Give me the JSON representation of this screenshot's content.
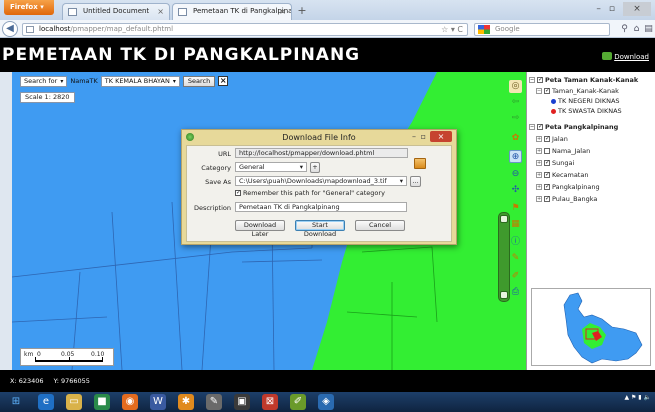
{
  "browser": {
    "app_button": "Firefox",
    "tabs": [
      {
        "label": "Untitled Document"
      },
      {
        "label": "Pemetaan TK di Pangkalpinang"
      }
    ],
    "url_host": "localhost",
    "url_path": "/pmapper/map_default.phtml",
    "search_engine": "Google"
  },
  "header": {
    "title": "PEMETAAN TK DI PANGKALPINANG",
    "download_label": "Download"
  },
  "toolbar": {
    "search_for": "Search for",
    "field": "NamaTK",
    "value": "TK KEMALA BHAYAN",
    "search_button": "Search",
    "scale_label": "Scale 1:",
    "scale_value": "2820"
  },
  "scalebar": {
    "unit": "km",
    "ticks": [
      "0",
      "0.05",
      "0.10"
    ]
  },
  "layers": {
    "groups": [
      {
        "label": "Peta Taman Kanak-Kanak",
        "items": [
          {
            "label": "Taman_Kanak-Kanak",
            "checked": true
          },
          {
            "label": "TK NEGERI DIKNAS",
            "legend_color": "#1a3fd0"
          },
          {
            "label": "TK SWASTA DIKNAS",
            "legend_color": "#e02020"
          }
        ]
      },
      {
        "label": "Peta Pangkalpinang",
        "items": [
          {
            "label": "Jalan",
            "checked": true
          },
          {
            "label": "Nama_Jalan",
            "checked": false
          },
          {
            "label": "Sungai",
            "checked": true
          },
          {
            "label": "Kecamatan",
            "checked": true
          },
          {
            "label": "Pangkalpinang",
            "checked": true
          },
          {
            "label": "Pulau_Bangka",
            "checked": true
          }
        ]
      }
    ]
  },
  "coords": {
    "x": "X: 623406",
    "y": "Y: 9766055"
  },
  "dialog": {
    "title": "Download File Info",
    "url_label": "URL",
    "url_value": "http://localhost/pmapper/download.phtml",
    "category_label": "Category",
    "category_value": "General",
    "add_category": "+",
    "saveas_label": "Save As",
    "saveas_value": "C:\\Users\\puah\\Downloads\\mapdownload_3.tif",
    "browse_label": "...",
    "remember_label": "Remember this path for \"General\" category",
    "remember_checked": true,
    "description_label": "Description",
    "description_value": "Pemetaan TK di Pangkalpinang",
    "btn_later": "Download Later",
    "btn_start": "Start Download",
    "btn_cancel": "Cancel"
  },
  "colors": {
    "water": "#3f9bf2",
    "land": "#33ee33",
    "header_bg": "#000000",
    "dialog_frame": "#e7d99a"
  }
}
